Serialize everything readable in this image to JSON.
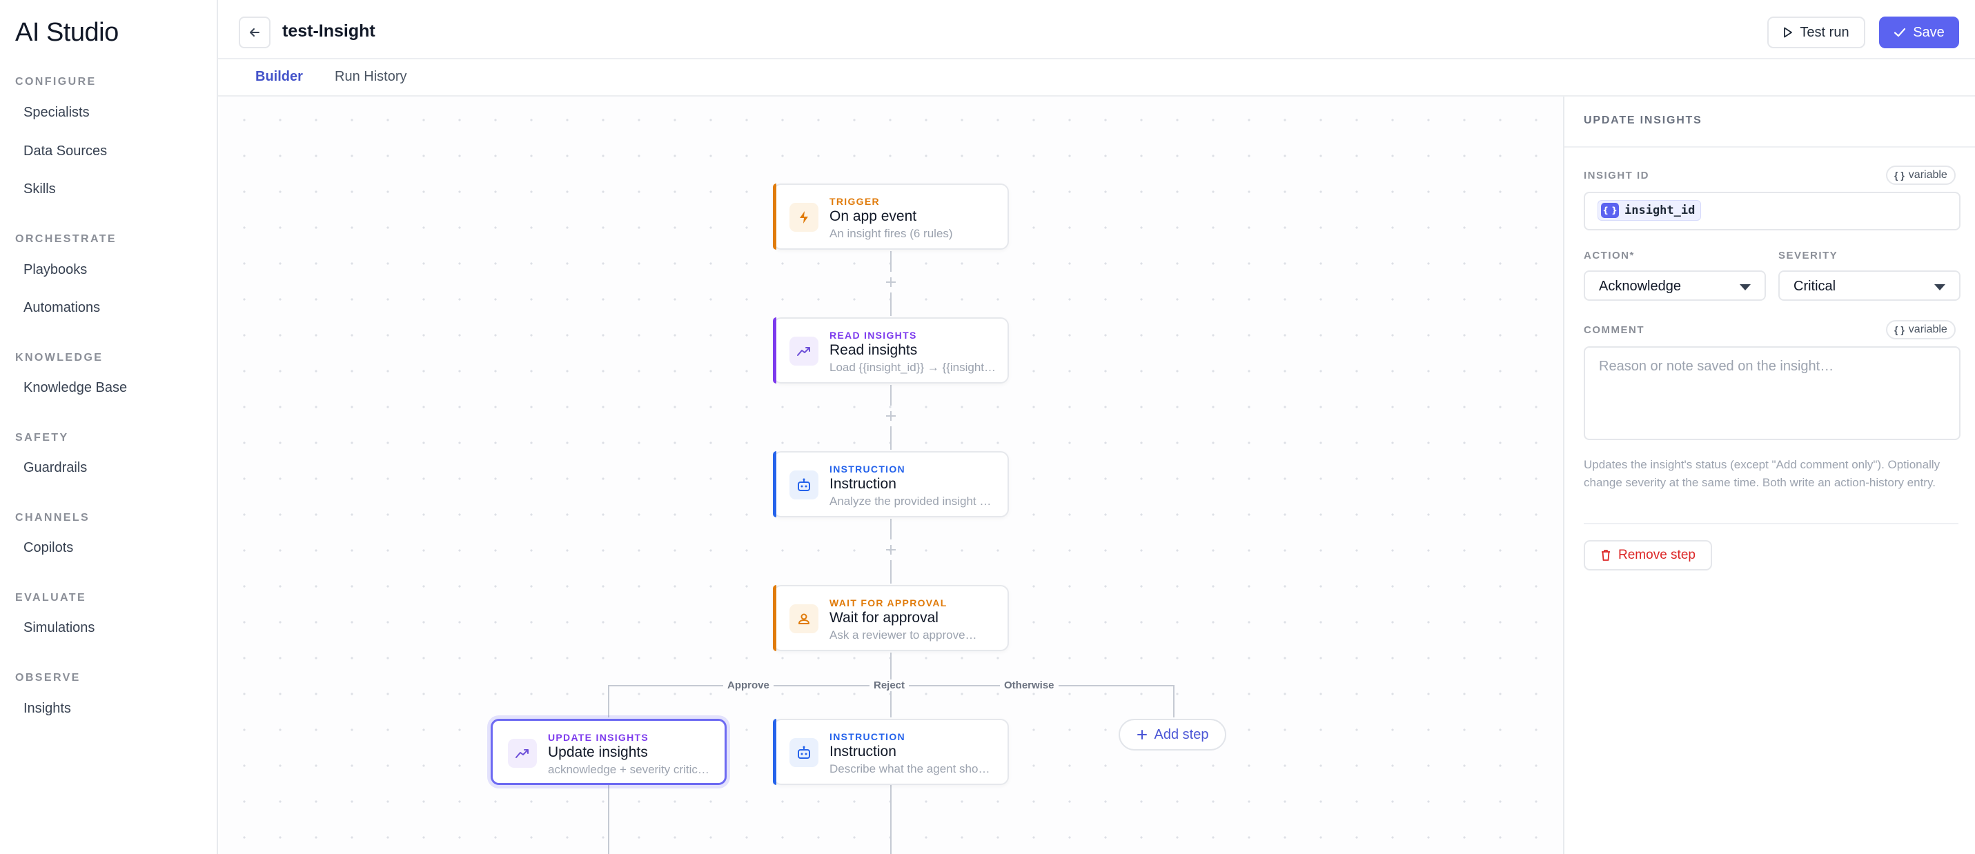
{
  "sidebar": {
    "brand": "AI Studio",
    "sections": [
      {
        "label": "CONFIGURE",
        "items": [
          "Specialists",
          "Data Sources",
          "Skills"
        ]
      },
      {
        "label": "ORCHESTRATE",
        "items": [
          "Playbooks",
          "Automations"
        ]
      },
      {
        "label": "KNOWLEDGE",
        "items": [
          "Knowledge Base"
        ]
      },
      {
        "label": "SAFETY",
        "items": [
          "Guardrails"
        ]
      },
      {
        "label": "CHANNELS",
        "items": [
          "Copilots"
        ]
      },
      {
        "label": "EVALUATE",
        "items": [
          "Simulations"
        ]
      },
      {
        "label": "OBSERVE",
        "items": [
          "Insights"
        ]
      }
    ]
  },
  "header": {
    "title": "test-Insight",
    "test_run_label": "Test run",
    "save_label": "Save"
  },
  "tabs": [
    {
      "label": "Builder",
      "active": true
    },
    {
      "label": "Run History",
      "active": false
    }
  ],
  "canvas": {
    "nodes": [
      {
        "kind": "TRIGGER",
        "title": "On app event",
        "subtitle": "An insight fires (6 rules)",
        "accent": "#e07b0b",
        "icon": "bolt-icon"
      },
      {
        "kind": "READ INSIGHTS",
        "title": "Read insights",
        "subtitle": "Load {{insight_id}} → {{insight…",
        "accent": "#7c3aed",
        "icon": "trend-icon"
      },
      {
        "kind": "INSTRUCTION",
        "title": "Instruction",
        "subtitle": "Analyze the provided insight …",
        "accent": "#2563eb",
        "icon": "robot-icon"
      },
      {
        "kind": "WAIT FOR APPROVAL",
        "title": "Wait for approval",
        "subtitle": "Ask a reviewer to approve…",
        "accent": "#e07b0b",
        "icon": "person-icon"
      },
      {
        "kind": "UPDATE INSIGHTS",
        "title": "Update insights",
        "subtitle": "acknowledge + severity critic…",
        "accent": "#7c3aed",
        "icon": "trend-icon",
        "selected": true
      },
      {
        "kind": "INSTRUCTION",
        "title": "Instruction",
        "subtitle": "Describe what the agent sho…",
        "accent": "#2563eb",
        "icon": "robot-icon"
      }
    ],
    "branches": [
      "Approve",
      "Reject",
      "Otherwise"
    ],
    "add_step_label": "Add step"
  },
  "panel": {
    "title": "UPDATE INSIGHTS",
    "insight_id_label": "INSIGHT ID",
    "variable_label": "variable",
    "insight_id_token": "insight_id",
    "action_label": "ACTION*",
    "action_value": "Acknowledge",
    "severity_label": "SEVERITY",
    "severity_value": "Critical",
    "comment_label": "COMMENT",
    "comment_placeholder": "Reason or note saved on the insight…",
    "help_text": "Updates the insight's status (except \"Add comment only\"). Optionally change severity at the same time. Both write an action-history entry.",
    "remove_label": "Remove step"
  },
  "colors": {
    "primary": "#5b63f0",
    "orange_accent": "#e07b0b",
    "purple_accent": "#7c3aed",
    "blue_accent": "#2563eb",
    "danger": "#dc2626"
  }
}
